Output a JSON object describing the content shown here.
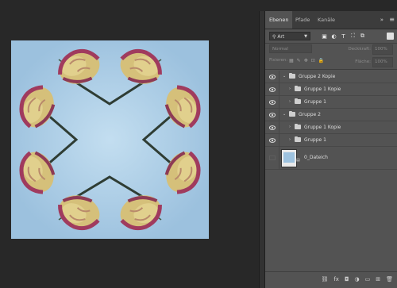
{
  "panel": {
    "tabs": [
      "Ebenen",
      "Pfade",
      "Kanäle"
    ],
    "collapse_glyph": "»",
    "menu_glyph": "≡",
    "filter": {
      "value": "Art",
      "icons": [
        "image-filter-icon",
        "adjustment-filter-icon",
        "type-filter-icon",
        "shape-filter-icon",
        "smart-object-filter-icon"
      ],
      "icon_glyphs": [
        "▣",
        "◐",
        "T",
        "⛶",
        "⧉"
      ]
    },
    "blend_mode": "Normal",
    "opacity_label": "Deckkraft:",
    "opacity_value": "100%",
    "lock_label": "Fixieren:",
    "lock_icons": [
      "▦",
      "✎",
      "✥",
      "⊡",
      "🔒"
    ],
    "fill_label": "Fläche:",
    "fill_value": "100%",
    "layers": [
      {
        "name": "Gruppe 2 Kopie",
        "indent": 0,
        "type": "group",
        "expanded": true,
        "visible": true
      },
      {
        "name": "Gruppe 1 Kopie",
        "indent": 1,
        "type": "group",
        "expanded": false,
        "visible": true
      },
      {
        "name": "Gruppe 1",
        "indent": 1,
        "type": "group",
        "expanded": false,
        "visible": true
      },
      {
        "name": "Gruppe 2",
        "indent": 0,
        "type": "group",
        "expanded": true,
        "visible": true
      },
      {
        "name": "Gruppe 1 Kopie",
        "indent": 1,
        "type": "group",
        "expanded": false,
        "visible": true
      },
      {
        "name": "Gruppe 1",
        "indent": 1,
        "type": "group",
        "expanded": false,
        "visible": true
      },
      {
        "name": "0_Dateich",
        "indent": 0,
        "type": "smart-object",
        "expanded": false,
        "visible": false
      }
    ],
    "bottom_icons": [
      "link-layers-icon",
      "fx-icon",
      "mask-icon",
      "adjustment-layer-icon",
      "new-group-icon",
      "new-layer-icon",
      "trash-icon"
    ],
    "bottom_glyphs": [
      "⛓",
      "fx",
      "◘",
      "◑",
      "▭",
      "⊞",
      "🗑"
    ]
  },
  "colors": {
    "canvas_bg": "#a8cbe6",
    "rose_petal": "#d8c47a",
    "rose_edge": "#9e3a5a",
    "stem": "#3a4b3a"
  }
}
